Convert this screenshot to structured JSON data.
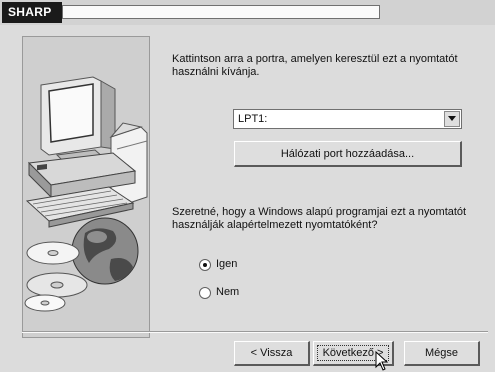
{
  "window": {
    "brand": "SHARP"
  },
  "prompt_port": "Kattintson arra a portra, amelyen keresztül ezt a nyomtatót használni kívánja.",
  "port_select": {
    "value": "LPT1:"
  },
  "add_port_button": "Hálózati port hozzáadása...",
  "prompt_default": "Szeretné, hogy a Windows alapú programjai ezt a nyomtatót használják alapértelmezett nyomtatóként?",
  "default_options": [
    {
      "label": "Igen",
      "selected": true
    },
    {
      "label": "Nem",
      "selected": false
    }
  ],
  "footer_buttons": {
    "back": "< Vissza",
    "next": "Következő >",
    "cancel": "Mégse"
  },
  "icons": {
    "dropdown": "chevron-down-icon",
    "cursor": "mouse-pointer-icon",
    "illustration": "computer-cd-illustration"
  }
}
